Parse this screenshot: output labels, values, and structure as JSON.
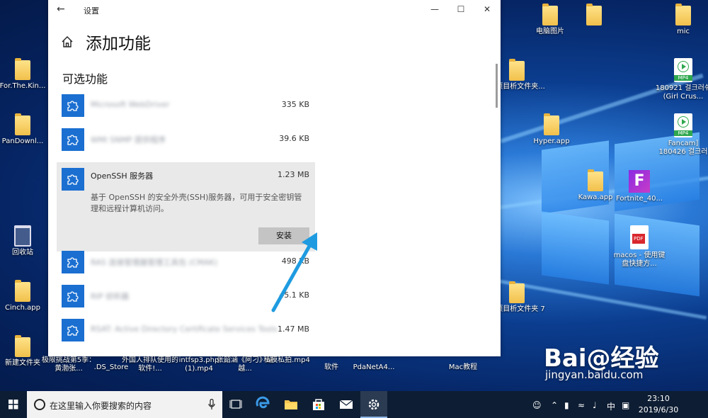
{
  "window": {
    "title": "设置",
    "page_title": "添加功能",
    "section_title": "可选功能"
  },
  "features": [
    {
      "name": "Microsoft WebDriver",
      "size": "335 KB",
      "blurred": true
    },
    {
      "name": "WMI SNMP 提供程序",
      "size": "39.6 KB",
      "blurred": true
    },
    {
      "name": "OpenSSH 服务器",
      "size": "1.23 MB",
      "blurred": false,
      "description": "基于 OpenSSH 的安全外壳(SSH)服务器，可用于安全密钥管理和远程计算机访问。",
      "install_label": "安装"
    },
    {
      "name": "RAS 连接管理器管理工具包 (CMAK)",
      "size": "498 KB",
      "blurred": true
    },
    {
      "name": "RIP 侦听器",
      "size": "45.1 KB",
      "blurred": true
    },
    {
      "name": "RSAT: Active Directory Certificate Services Tools",
      "size": "1.47 MB",
      "blurred": true
    }
  ],
  "desktop_icons": {
    "left": [
      {
        "label": "For.The.Kin...",
        "type": "folder"
      },
      {
        "label": "PanDownl...",
        "type": "folder"
      },
      {
        "label": "回收站",
        "type": "recycle-bin"
      },
      {
        "label": "Cinch.app",
        "type": "folder"
      },
      {
        "label": "新建文件夹",
        "type": "folder"
      }
    ],
    "bottom": [
      {
        "label": "极限挑战第5季：黄渤张...",
        "type": "mp4"
      },
      {
        "label": ".DS_Store",
        "type": "file"
      },
      {
        "label": "外国人排队使用的软件!...",
        "type": "mp4"
      },
      {
        "label": "intfsp3.php (1).mp4",
        "type": "mp4"
      },
      {
        "label": "张韶涵《阿刁》超越...",
        "type": "avi"
      },
      {
        "label": "私模私拍.mp4",
        "type": "mp4"
      },
      {
        "label": "软件",
        "type": "folder"
      },
      {
        "label": "PdaNetA4...",
        "type": "app"
      },
      {
        "label": "Mac教程",
        "type": "folder"
      }
    ],
    "right": [
      {
        "label": "电脑图片",
        "type": "folder"
      },
      {
        "label": "",
        "type": "folder"
      },
      {
        "label": "mic",
        "type": "folder"
      },
      {
        "label": "选项目析文件夹...",
        "type": "folder"
      },
      {
        "label": "180921 걸크러쉬(Girl Crus...",
        "type": "mp4"
      },
      {
        "label": "Hyper.app",
        "type": "folder"
      },
      {
        "label": "Fancam] 180426 걸크러",
        "type": "mp4"
      },
      {
        "label": "Kawa.app",
        "type": "folder"
      },
      {
        "label": "Fortnite_40...",
        "type": "fortnite"
      },
      {
        "label": "macos - 使用键盘快捷方...",
        "type": "pdf"
      },
      {
        "label": "选项目析文件夹 7",
        "type": "folder"
      }
    ]
  },
  "taskbar": {
    "search_placeholder": "在这里输入你要搜索的内容",
    "ime": "中",
    "time": "23:10",
    "date": "2019/6/30"
  },
  "watermark": {
    "logo": "Bai@经验",
    "url": "jingyan.baidu.com"
  },
  "colors": {
    "feature_icon": "#1a6fd1",
    "install_button": "#c4c4c4",
    "selected_bg": "#e9e9e9",
    "arrow": "#1e9be0"
  }
}
